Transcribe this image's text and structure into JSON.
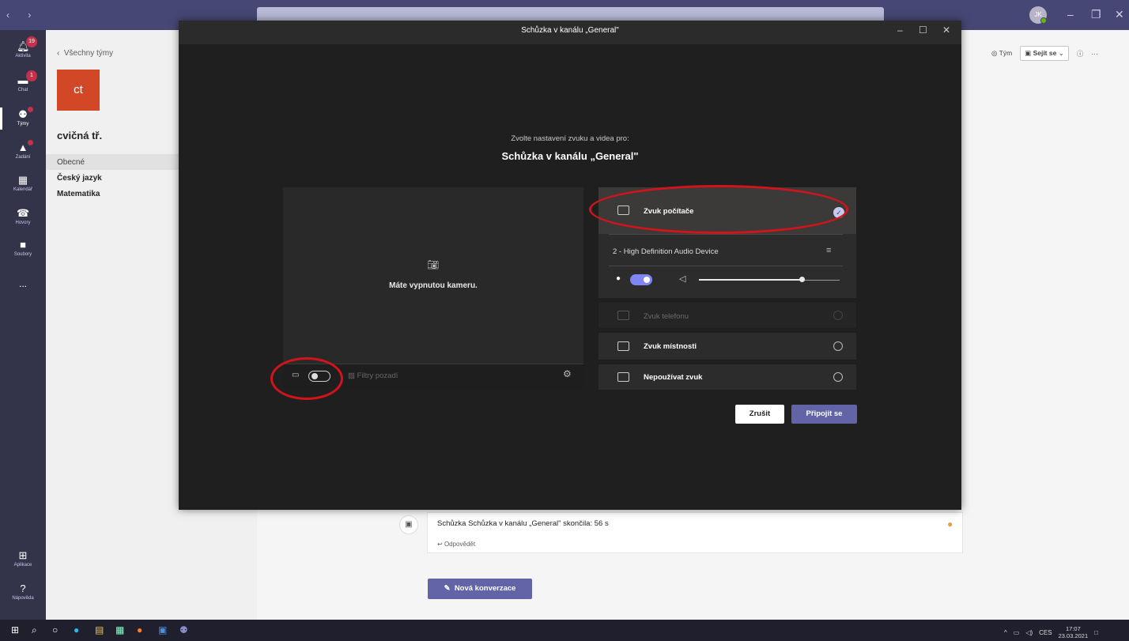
{
  "app": {
    "rail": [
      {
        "label": "Aktivita",
        "icon": "bell-icon",
        "badge": "19"
      },
      {
        "label": "Chat",
        "icon": "chat-icon",
        "badge": "1"
      },
      {
        "label": "Týmy",
        "icon": "teams-icon",
        "dot": true
      },
      {
        "label": "Zadání",
        "icon": "assignments-icon",
        "dot": true
      },
      {
        "label": "Kalendář",
        "icon": "calendar-icon"
      },
      {
        "label": "Hovory",
        "icon": "phone-icon"
      },
      {
        "label": "Soubory",
        "icon": "file-icon"
      },
      {
        "label": "...",
        "icon": "more-icon"
      }
    ],
    "rail_bottom": [
      {
        "label": "Aplikace",
        "icon": "apps-icon"
      },
      {
        "label": "Nápověda",
        "icon": "help-icon"
      }
    ],
    "avatar_initials": "JK"
  },
  "team_pane": {
    "back_label": "Všechny týmy",
    "tile_text": "ct",
    "team_name": "cvičná tř.",
    "channels": [
      "Obecné",
      "Český jazyk",
      "Matematika"
    ]
  },
  "main": {
    "team_button": "Tým",
    "meet_button": "Sejít se",
    "meeting_card_text": "Schůzka Schůzka v kanálu „General\" skončila: 56 s",
    "reply_label": "Odpovědět",
    "new_conversation": "Nová konverzace"
  },
  "dialog": {
    "title": "Schůzka v kanálu „General\"",
    "prompt": "Zvolte nastavení zvuku a videa pro:",
    "subtitle": "Schůzka v kanálu „General\"",
    "camera_off": "Máte vypnutou kameru.",
    "filters": "Filtry pozadí",
    "audio_options": [
      {
        "label": "Zvuk počítače",
        "selected": true
      },
      {
        "label": "Zvuk telefonu",
        "disabled": true
      },
      {
        "label": "Zvuk místnosti"
      },
      {
        "label": "Nepoužívat zvuk"
      }
    ],
    "device": "2 - High Definition Audio Device",
    "volume_fraction": 0.73,
    "mic_on": true,
    "camera_on": false,
    "cancel": "Zrušit",
    "join": "Připojit se"
  },
  "taskbar": {
    "lang": "CES",
    "time": "17:07",
    "date": "23.03.2021"
  },
  "colors": {
    "brand": "#6264a7",
    "annotation": "#d1141c",
    "dialog_bg": "#201f1f"
  }
}
